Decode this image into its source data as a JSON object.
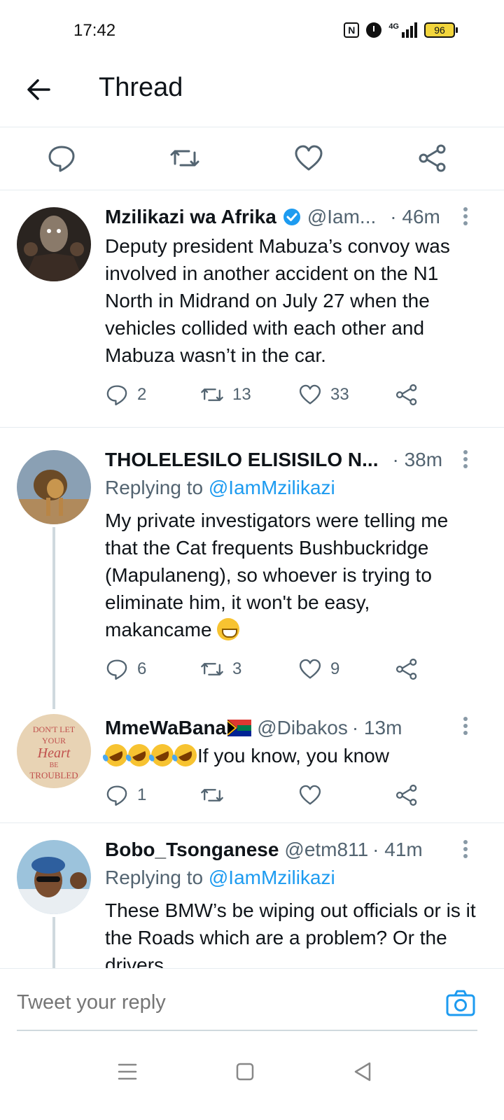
{
  "status_bar": {
    "time": "17:42",
    "network": "4G",
    "battery": "96",
    "battery_color": "#f2d53c"
  },
  "header": {
    "title": "Thread"
  },
  "icons": {
    "back": "arrow-left-icon",
    "reply": "comment-icon",
    "retweet": "retweet-icon",
    "like": "heart-icon",
    "share": "share-icon",
    "more": "more-vertical-icon",
    "verified": "verified-badge-icon",
    "camera": "camera-icon"
  },
  "colors": {
    "accent": "#1d9bf0",
    "muted": "#536471",
    "thread_line": "#cfd9de"
  },
  "tweets": [
    {
      "name": "Mzilikazi wa Afrika",
      "verified": true,
      "handle": "@Iam...",
      "time": "· 46m",
      "body": "Deputy president Mabuza’s convoy was involved in another accident on the N1 North in Midrand on July 27 when the vehicles collided with each other and Mabuza wasn’t in the car.",
      "replies": "2",
      "retweets": "13",
      "likes": "33"
    },
    {
      "name": "THOLELESILO ELISISILO N...",
      "time": "· 38m",
      "replying_prefix": "Replying to",
      "replying_to": "@IamMzilikazi",
      "body": "My private investigators were telling me that the Cat frequents Bushbuckridge (Mapulaneng), so whoever is trying to eliminate him, it won't be easy, makancame",
      "replies": "6",
      "retweets": "3",
      "likes": "9"
    },
    {
      "name": "MmeWaBana",
      "handle": "@Dibakos",
      "time": "· 13m",
      "body": "If you know, you know",
      "replies": "1",
      "retweets": "",
      "likes": ""
    },
    {
      "name": "Bobo_Tsonganese",
      "handle": "@etm811",
      "time": "· 41m",
      "replying_prefix": "Replying to",
      "replying_to": "@IamMzilikazi",
      "body": "These BMW’s be wiping out officials or is it the Roads which are a problem? Or the drivers"
    }
  ],
  "reply_bar": {
    "placeholder": "Tweet your reply"
  },
  "nav": {
    "items": [
      "menu-icon",
      "home-square-icon",
      "back-triangle-icon"
    ]
  }
}
